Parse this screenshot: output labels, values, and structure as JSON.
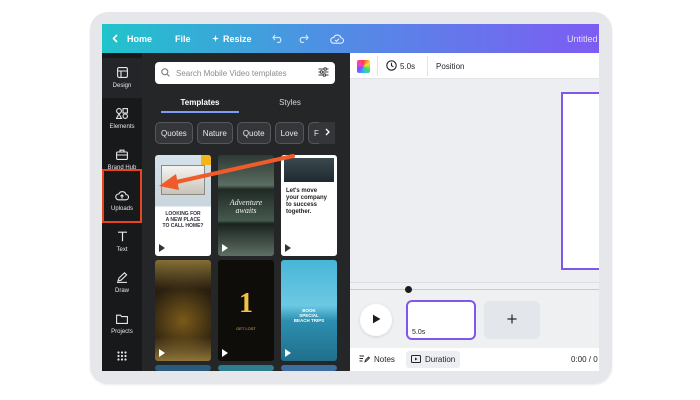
{
  "topbar": {
    "home_label": "Home",
    "file_label": "File",
    "resize_label": "Resize",
    "title": "Untitled"
  },
  "rail": {
    "items": [
      {
        "label": "Design",
        "icon": "layout-icon"
      },
      {
        "label": "Elements",
        "icon": "shapes-icon"
      },
      {
        "label": "Brand Hub",
        "icon": "briefcase-icon"
      },
      {
        "label": "Uploads",
        "icon": "cloud-upload-icon"
      },
      {
        "label": "Text",
        "icon": "text-icon"
      },
      {
        "label": "Draw",
        "icon": "pen-icon"
      },
      {
        "label": "Projects",
        "icon": "folder-icon"
      },
      {
        "label": "",
        "icon": "apps-grid-icon"
      }
    ]
  },
  "panel": {
    "search_placeholder": "Search Mobile Video templates",
    "tabs": [
      {
        "label": "Templates",
        "active": true
      },
      {
        "label": "Styles",
        "active": false
      }
    ],
    "chips": [
      "Quotes",
      "Nature",
      "Quote",
      "Love",
      "Foo"
    ],
    "thumbs": [
      {
        "lines": [
          "LOOKING FOR",
          "A NEW PLACE",
          "TO CALL HOME?"
        ]
      },
      {
        "lines": [
          "Adventure",
          "awaits"
        ]
      },
      {
        "lines": [
          "Let's move",
          "your company",
          "to success",
          "together."
        ]
      },
      {
        "lines": [
          ""
        ]
      },
      {
        "lines": [
          "1",
          "GET LOST"
        ]
      },
      {
        "lines": [
          "BOOK",
          "SPECIAL",
          "BEACH TRIPS"
        ]
      }
    ]
  },
  "editor": {
    "duration": "5.0s",
    "position_label": "Position",
    "clip_duration": "5.0s",
    "notes_label": "Notes",
    "duration_label": "Duration",
    "time_readout": "0:00 / 0"
  },
  "colors": {
    "accent_orange": "#e8451f",
    "page_border": "#7f58ea",
    "rail_bg": "#18191b"
  }
}
